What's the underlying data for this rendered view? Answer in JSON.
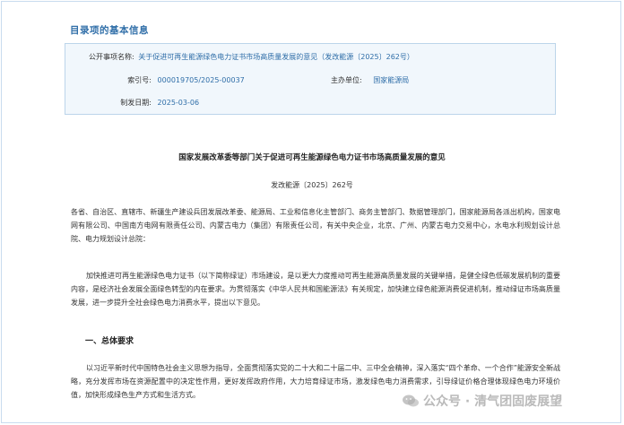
{
  "section": {
    "title": "目录项的基本信息"
  },
  "info": {
    "public_item_label": "公开事项名称:",
    "public_item_value": "关于促进可再生能源绿色电力证书市场高质量发展的意见（发改能源〔2025〕262号）",
    "index_label": "索引号:",
    "index_value": "000019705/2025-00037",
    "dept_label": "主办单位:",
    "dept_value": "国家能源局",
    "date_label": "制发日期:",
    "date_value": "2025-03-06"
  },
  "document": {
    "title": "国家发展改革委等部门关于促进可再生能源绿色电力证书市场高质量发展的意见",
    "number": "发改能源〔2025〕262号",
    "addressees": "各省、自治区、直辖市、新疆生产建设兵团发展改革委、能源局、工业和信息化主管部门、商务主管部门、数据管理部门，国家能源局各派出机构，国家电网有限公司、中国南方电网有限责任公司、内蒙古电力（集团）有限责任公司，有关中央企业，北京、广州、内蒙古电力交易中心，水电水利规划设计总院、电力规划设计总院：",
    "intro": "加快推进可再生能源绿色电力证书（以下简称绿证）市场建设，是以更大力度推动可再生能源高质量发展的关键举措，是健全绿色低碳发展机制的重要内容，是经济社会发展全面绿色转型的内在要求。为贯彻落实《中华人民共和国能源法》有关规定，加快建立绿色能源消费促进机制，推动绿证市场高质量发展，进一步提升全社会绿色电力消费水平，提出以下意见。",
    "heading1": "一、总体要求",
    "body1": "以习近平新时代中国特色社会主义思想为指导，全面贯彻落实党的二十大和二十届二中、三中全会精神，深入落实“四个革命、一个合作”能源安全新战略，充分发挥市场在资源配置中的决定性作用，更好发挥政府作用，大力培育绿证市场，激发绿色电力消费需求，引导绿证价格合理体现绿色电力环境价值，加快形成绿色生产方式和生活方式。"
  },
  "watermark": {
    "text": "公众号 · 清气团固废展望",
    "icon": "wechat-icon"
  }
}
